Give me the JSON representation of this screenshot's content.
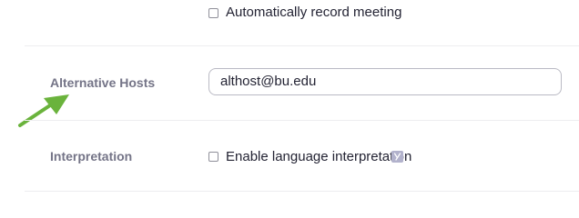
{
  "auto_record": {
    "label": "Automatically record meeting",
    "checked": false
  },
  "alternative_hosts": {
    "label": "Alternative Hosts",
    "value": "althost@bu.edu"
  },
  "interpretation": {
    "label": "Interpretation",
    "option_label": "Enable language interpretation",
    "checked": false,
    "help_icon": "info-icon"
  },
  "annotation": {
    "arrow_icon": "arrow-icon",
    "arrow_color": "#6ab33c"
  }
}
